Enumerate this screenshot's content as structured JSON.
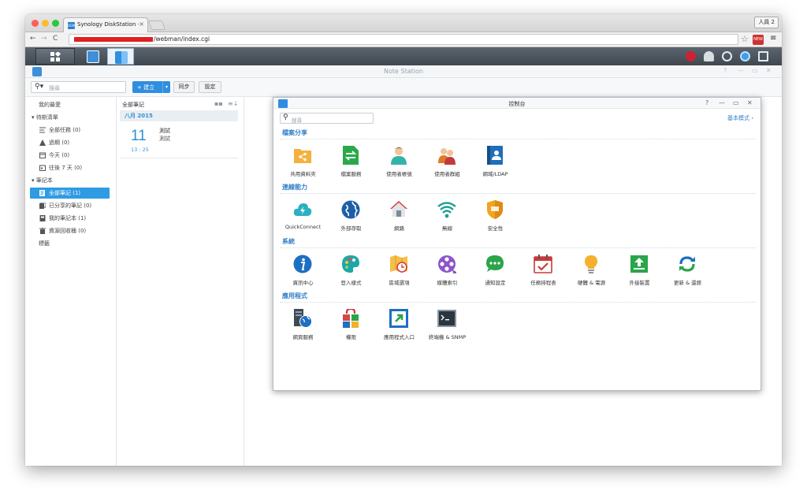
{
  "browser": {
    "tab_title": "Synology DiskStation - Note Station",
    "tab_favicon": "DSM",
    "tab_close": "×",
    "profile": "人員 2",
    "url": "/webman/index.cgi",
    "ext_badge": "NEW",
    "colors": {
      "red": "#fd5f57",
      "yellow": "#fdbc2e",
      "green": "#28c840"
    }
  },
  "app": {
    "title": "Note Station",
    "search_placeholder": "搜尋",
    "new_button": "+ 建立",
    "sync_button": "同步",
    "settings_button": "設定"
  },
  "sidebar": {
    "items": [
      {
        "label": "我的最愛",
        "icon": ""
      },
      {
        "label": "▾ 待辦清單",
        "icon": ""
      },
      {
        "label": "全部任務 (0)",
        "icon": "list-icon"
      },
      {
        "label": "過期 (0)",
        "icon": "warning-icon"
      },
      {
        "label": "今天 (0)",
        "icon": "calendar-icon"
      },
      {
        "label": "往後 7 天 (0)",
        "icon": "calendar-week-icon"
      },
      {
        "label": "▾ 筆記本",
        "icon": ""
      },
      {
        "label": "全部筆記 (1)",
        "icon": "notes-icon"
      },
      {
        "label": "已分享的筆記 (0)",
        "icon": "shared-icon"
      },
      {
        "label": "我的筆記本 (1)",
        "icon": "notebook-icon"
      },
      {
        "label": "資源回收桶 (0)",
        "icon": "trash-icon"
      },
      {
        "label": "標籤",
        "icon": ""
      }
    ]
  },
  "notelist": {
    "header": "全部筆記",
    "month": "八月 2015",
    "notes": [
      {
        "day": "11",
        "time": "13 : 25",
        "title": "測試",
        "body": "測試"
      }
    ]
  },
  "control_panel": {
    "title": "控制台",
    "search_placeholder": "搜尋",
    "mode_link": "基本模式",
    "sections": [
      {
        "title": "檔案分享",
        "items": [
          {
            "label": "共用資料夾",
            "icon": "shared-folder-icon"
          },
          {
            "label": "檔案服務",
            "icon": "file-services-icon"
          },
          {
            "label": "使用者帳號",
            "icon": "user-icon"
          },
          {
            "label": "使用者群組",
            "icon": "group-icon"
          },
          {
            "label": "網域/LDAP",
            "icon": "domain-ldap-icon"
          }
        ]
      },
      {
        "title": "連線能力",
        "items": [
          {
            "label": "QuickConnect",
            "icon": "quickconnect-icon"
          },
          {
            "label": "外部存取",
            "icon": "external-access-icon"
          },
          {
            "label": "網路",
            "icon": "network-icon"
          },
          {
            "label": "無線",
            "icon": "wireless-icon"
          },
          {
            "label": "安全性",
            "icon": "security-icon"
          }
        ]
      },
      {
        "title": "系統",
        "items": [
          {
            "label": "資訊中心",
            "icon": "info-center-icon"
          },
          {
            "label": "登入樣式",
            "icon": "theme-icon"
          },
          {
            "label": "區域選項",
            "icon": "regional-options-icon"
          },
          {
            "label": "媒體索引",
            "icon": "media-index-icon"
          },
          {
            "label": "通知設定",
            "icon": "notification-icon"
          },
          {
            "label": "任務排程表",
            "icon": "task-scheduler-icon"
          },
          {
            "label": "硬體 & 電源",
            "icon": "hardware-power-icon"
          },
          {
            "label": "外接裝置",
            "icon": "external-devices-icon"
          },
          {
            "label": "更新 & 還原",
            "icon": "update-restore-icon"
          }
        ]
      },
      {
        "title": "應用程式",
        "items": [
          {
            "label": "網頁服務",
            "icon": "web-services-icon"
          },
          {
            "label": "權限",
            "icon": "privileges-icon"
          },
          {
            "label": "應用程式入口",
            "icon": "application-portal-icon"
          },
          {
            "label": "終端機 & SNMP",
            "icon": "terminal-snmp-icon"
          }
        ]
      }
    ]
  }
}
